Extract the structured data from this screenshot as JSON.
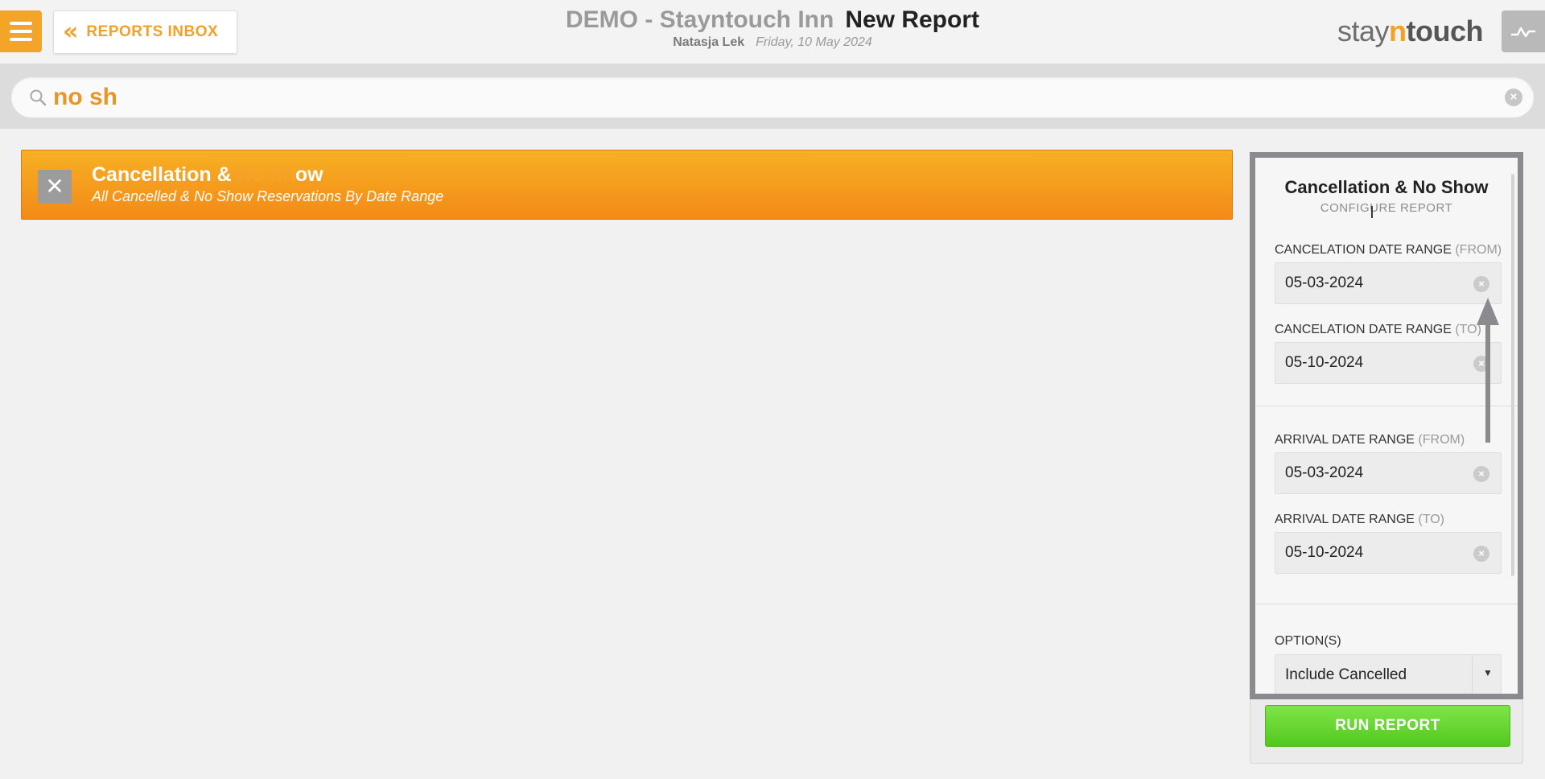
{
  "header": {
    "back_button_label": "REPORTS INBOX",
    "hotel_name": "DEMO - Stayntouch Inn",
    "report_title": "New Report",
    "user_name": "Natasja Lek",
    "date": "Friday, 10 May 2024",
    "logo": {
      "part1": "stay",
      "part2": "n",
      "part3": "touch"
    }
  },
  "search": {
    "value": "no sh"
  },
  "result": {
    "title_before": "Cancellation & ",
    "title_highlight": "No Sh",
    "title_after": "ow",
    "description": "All Cancelled & No Show Reservations By Date Range"
  },
  "panel": {
    "title": "Cancellation & No Show",
    "subtitle": "CONFIGURE REPORT",
    "fields": [
      {
        "label": "CANCELATION DATE RANGE",
        "qualifier": "(FROM)",
        "value": "05-03-2024"
      },
      {
        "label": "CANCELATION DATE RANGE",
        "qualifier": "(TO)",
        "value": "05-10-2024"
      },
      {
        "label": "ARRIVAL DATE RANGE",
        "qualifier": "(FROM)",
        "value": "05-03-2024"
      },
      {
        "label": "ARRIVAL DATE RANGE",
        "qualifier": "(TO)",
        "value": "05-10-2024"
      }
    ],
    "options_label": "OPTION(S)",
    "options_value": "Include Cancelled"
  },
  "run_button_label": "RUN REPORT",
  "colors": {
    "accent": "#f0a127",
    "result_bg": "#f38a17",
    "run_button": "#52c81e",
    "panel_frame": "#8a8a8f"
  }
}
